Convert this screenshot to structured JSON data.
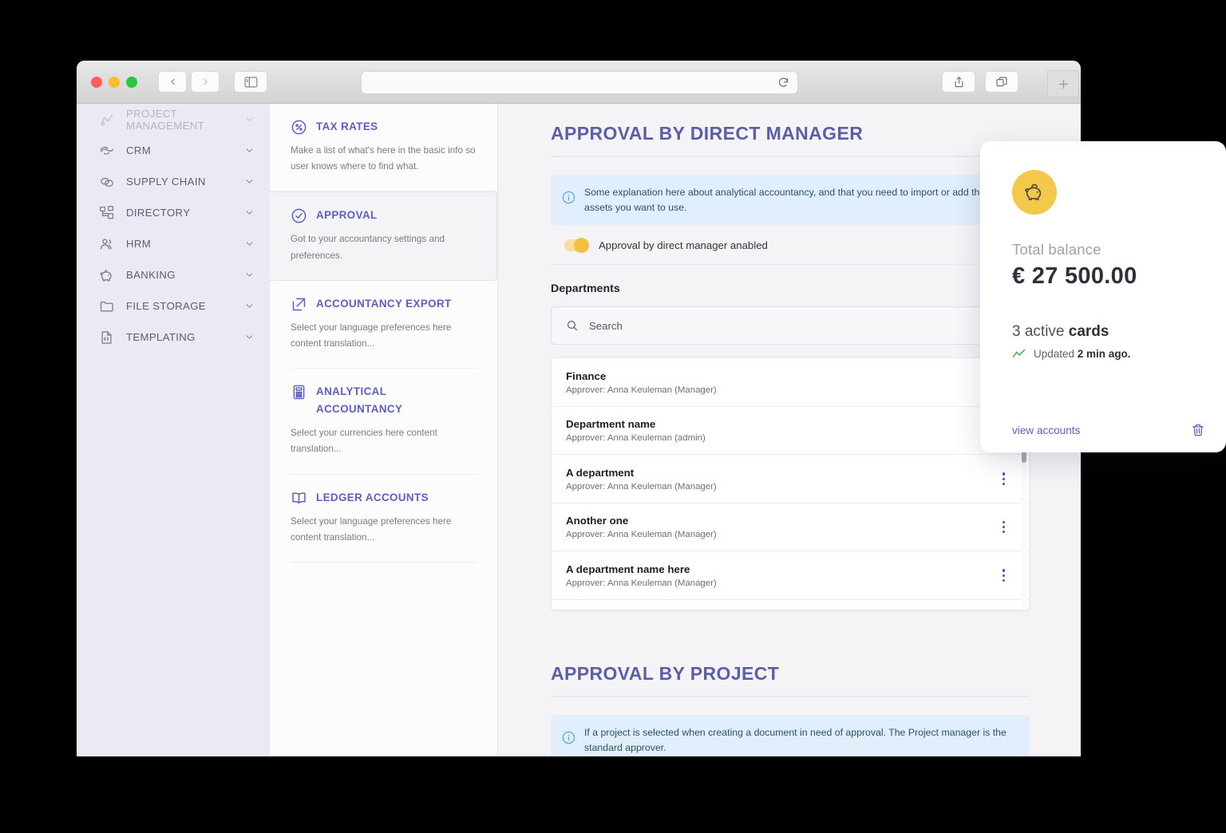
{
  "browser": {
    "address_value": "",
    "reload_icon": "reload-icon",
    "back_icon": "chevron-left-icon",
    "forward_icon": "chevron-right-icon",
    "sidebar_toggle_icon": "sidebar-toggle-icon",
    "share_icon": "share-icon",
    "tabs_overview_icon": "tabs-overview-icon",
    "new_tab_icon": "plus-icon"
  },
  "sidebar": {
    "items": [
      {
        "label": "PROJECT MANAGEMENT",
        "icon": "project-management-icon",
        "faded": true
      },
      {
        "label": "CRM",
        "icon": "crm-icon",
        "faded": false
      },
      {
        "label": "SUPPLY CHAIN",
        "icon": "supply-chain-icon",
        "faded": false
      },
      {
        "label": "DIRECTORY",
        "icon": "directory-icon",
        "faded": false
      },
      {
        "label": "HRM",
        "icon": "hrm-icon",
        "faded": false
      },
      {
        "label": "BANKING",
        "icon": "banking-icon",
        "faded": false
      },
      {
        "label": "FILE STORAGE",
        "icon": "file-storage-icon",
        "faded": false
      },
      {
        "label": "TEMPLATING",
        "icon": "templating-icon",
        "faded": false
      }
    ]
  },
  "settings": {
    "cards": [
      {
        "title": "TAX RATES",
        "icon": "percent-icon",
        "desc": "Make a list of what's here in the basic info so user knows where to find what.",
        "selected": false
      },
      {
        "title": "APPROVAL",
        "icon": "check-circle-icon",
        "desc": "Got to your accountancy settings and preferences.",
        "selected": true
      },
      {
        "title": "ACCOUNTANCY EXPORT",
        "icon": "external-link-icon",
        "desc": "Select your language preferences here content translation...",
        "selected": false
      },
      {
        "title": "ANALYTICAL ACCOUNTANCY",
        "icon": "calculator-icon",
        "desc": "Select your currencies here content translation...",
        "selected": false
      },
      {
        "title": "LEDGER ACCOUNTS",
        "icon": "book-icon",
        "desc": "Select your language preferences here content translation...",
        "selected": false
      }
    ]
  },
  "main": {
    "section1": {
      "title": "APPROVAL BY DIRECT MANAGER",
      "info_icon": "info-icon",
      "info_text": "Some explanation here about analytical accountancy, and that you need to import or add the cost assets you want to use.",
      "toggle_label": "Approval by direct manager anabled",
      "toggle_on": true,
      "toggle_color": "#f3c13f"
    },
    "departments": {
      "label": "Departments",
      "search_placeholder": "Search",
      "search_value": "",
      "search_icon": "search-icon",
      "rows": [
        {
          "name": "Finance",
          "approver": "Approver: Anna Keuleman (Manager)"
        },
        {
          "name": "Department name",
          "approver": "Approver: Anna Keuleman (admin)"
        },
        {
          "name": "A department",
          "approver": "Approver: Anna Keuleman (Manager)"
        },
        {
          "name": "Another one",
          "approver": "Approver: Anna Keuleman (Manager)"
        },
        {
          "name": "A department name here",
          "approver": "Approver: Anna Keuleman (Manager)"
        }
      ]
    },
    "section2": {
      "title": "APPROVAL BY PROJECT",
      "info_icon": "info-icon",
      "info_text": "If a project is selected when creating a document in need of approval. The Project manager is the standard approver."
    }
  },
  "balance_card": {
    "piggy_icon": "piggy-bank-icon",
    "label": "Total balance",
    "amount": "€ 27 500.00",
    "cards_count": "3 active ",
    "cards_word": "cards",
    "trend_icon": "trend-up-icon",
    "updated_prefix": "Updated ",
    "updated_value": "2 min ago.",
    "view_accounts": "view accounts",
    "trash_icon": "trash-icon",
    "accent": "#5c5fc4",
    "piggy_bg": "#f3c84b"
  }
}
